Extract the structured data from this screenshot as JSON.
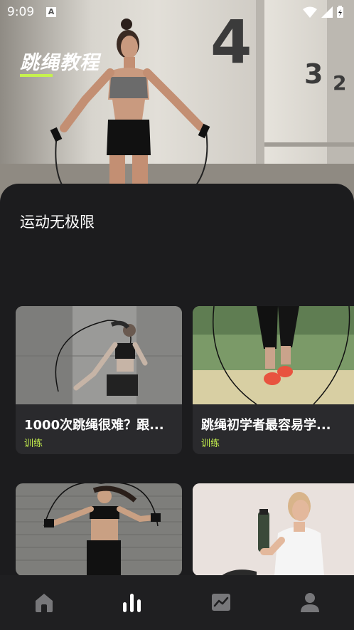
{
  "status_bar": {
    "time": "9:09",
    "notification_icon": "a-icon"
  },
  "hero": {
    "title": "跳绳教程"
  },
  "section": {
    "subtitle": "运动无极限"
  },
  "cards": [
    {
      "title": "1000次跳绳很难？跟...",
      "tag": "训练"
    },
    {
      "title": "跳绳初学者最容易学...",
      "tag": "训练"
    },
    {
      "title": "",
      "tag": ""
    },
    {
      "title": "",
      "tag": ""
    }
  ],
  "nav": {
    "items": [
      {
        "icon": "home-icon",
        "active": false
      },
      {
        "icon": "bar-chart-icon",
        "active": true
      },
      {
        "icon": "trend-chart-icon",
        "active": false
      },
      {
        "icon": "profile-icon",
        "active": false
      }
    ],
    "active_color": "#ffffff",
    "inactive_color": "#77777a"
  },
  "colors": {
    "accent": "#c6f24e",
    "background": "#1c1c1e"
  }
}
